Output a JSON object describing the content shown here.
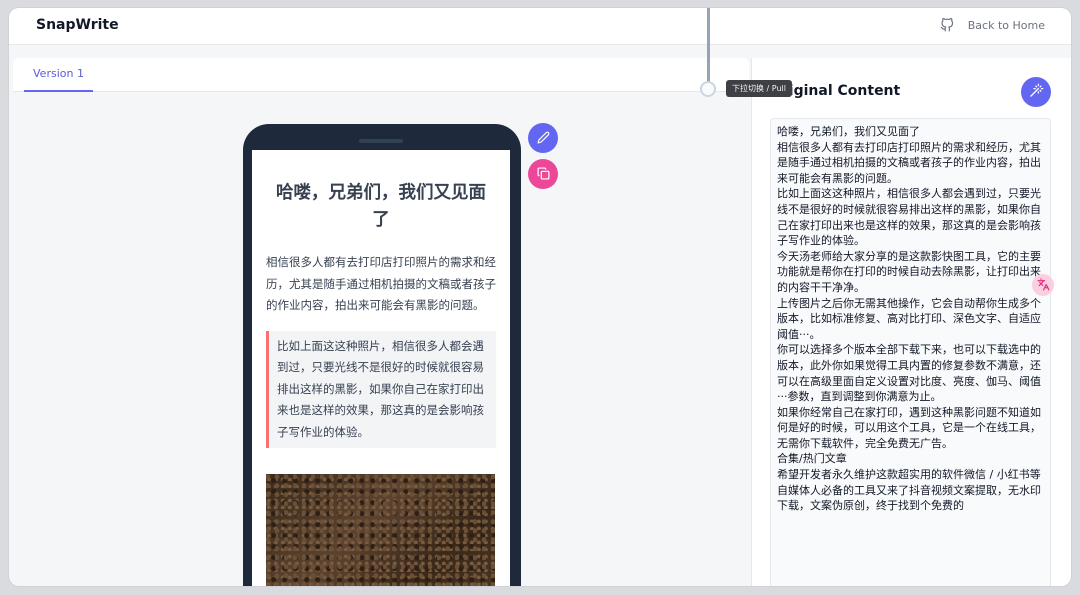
{
  "header": {
    "brand": "SnapWrite",
    "home_label": "Back to Home"
  },
  "tabs": [
    {
      "label": "Version 1"
    }
  ],
  "tooltip": "下拉切换 / Pull",
  "preview": {
    "title": "哈喽，兄弟们，我们又见面了",
    "paragraph": "相信很多人都有去打印店打印照片的需求和经历，尤其是随手通过相机拍摄的文稿或者孩子的作业内容，拍出来可能会有黑影的问题。",
    "quote": "比如上面这这种照片，相信很多人都会遇到过，只要光线不是很好的时候就很容易排出这样的黑影，如果你自己在家打印出来也是这样的效果，那这真的是会影响孩子写作业的体验。"
  },
  "right_panel": {
    "title": "Original Content",
    "content": "哈喽，兄弟们，我们又见面了\n相信很多人都有去打印店打印照片的需求和经历，尤其是随手通过相机拍摄的文稿或者孩子的作业内容，拍出来可能会有黑影的问题。\n比如上面这这种照片，相信很多人都会遇到过，只要光线不是很好的时候就很容易排出这样的黑影，如果你自己在家打印出来也是这样的效果，那这真的是会影响孩子写作业的体验。\n今天汤老师给大家分享的是这款影快图工具，它的主要功能就是帮你在打印的时候自动去除黑影，让打印出来的内容干干净净。\n上传图片之后你无需其他操作，它会自动帮你生成多个版本，比如标准修复、高对比打印、深色文字、自适应阈值···。\n你可以选择多个版本全部下载下来，也可以下载选中的版本，此外你如果觉得工具内置的修复参数不满意，还可以在高级里面自定义设置对比度、亮度、伽马、阈值···参数，直到调整到你满意为止。\n如果你经常自己在家打印，遇到这种黑影问题不知道如何是好的时候，可以用这个工具，它是一个在线工具，无需你下载软件，完全免费无广告。\n合集/热门文章\n希望开发者永久维护这款超实用的软件微信 / 小红书等自媒体人必备的工具又来了抖音视频文案提取，无水印下载，文案伪原创，终于找到个免费的"
  },
  "icons": {
    "home": "github-icon",
    "edit": "pencil-icon",
    "copy": "copy-icon",
    "magic": "magic-wand-icon",
    "side": "translate-icon"
  },
  "colors": {
    "accent": "#6366f1",
    "pink": "#ec4899",
    "quote_border": "#f87171"
  }
}
